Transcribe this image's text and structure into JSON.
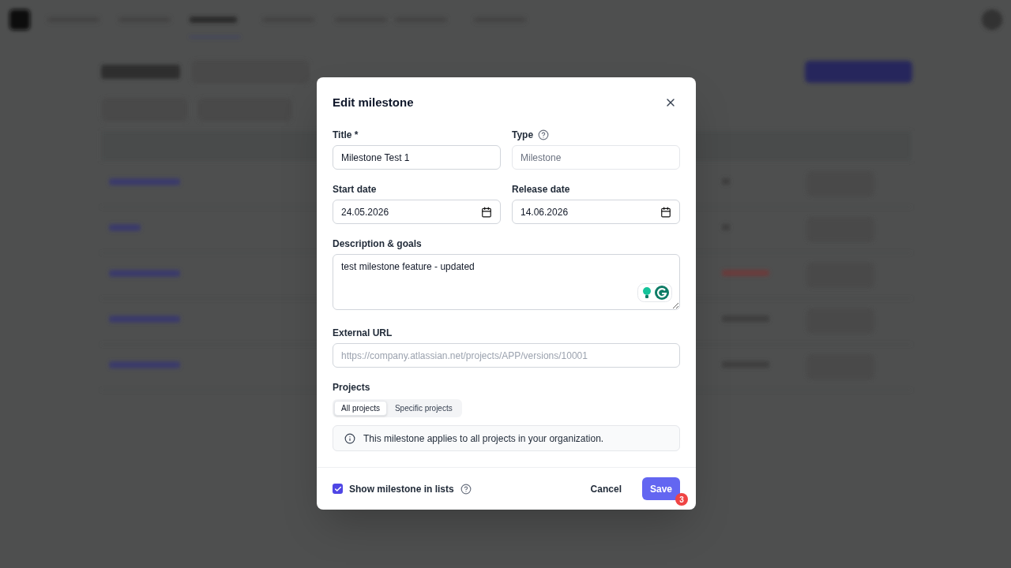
{
  "dialog": {
    "title": "Edit milestone",
    "title_field": {
      "label": "Title *",
      "value": "Milestone Test 1"
    },
    "type_field": {
      "label": "Type",
      "placeholder": "Milestone"
    },
    "start_date": {
      "label": "Start date",
      "value": "24.05.2026"
    },
    "release_date": {
      "label": "Release date",
      "value": "14.06.2026"
    },
    "description": {
      "label": "Description & goals",
      "value": "test milestone feature - updated"
    },
    "external_url": {
      "label": "External URL",
      "placeholder": "https://company.atlassian.net/projects/APP/versions/10001"
    },
    "projects": {
      "label": "Projects",
      "options": [
        {
          "label": "All projects",
          "selected": true
        },
        {
          "label": "Specific projects",
          "selected": false
        }
      ],
      "info": "This milestone applies to all projects in your organization."
    },
    "show_in_lists": {
      "label": "Show milestone in lists",
      "checked": true
    },
    "cancel": "Cancel",
    "save": "Save",
    "save_badge": "3"
  }
}
